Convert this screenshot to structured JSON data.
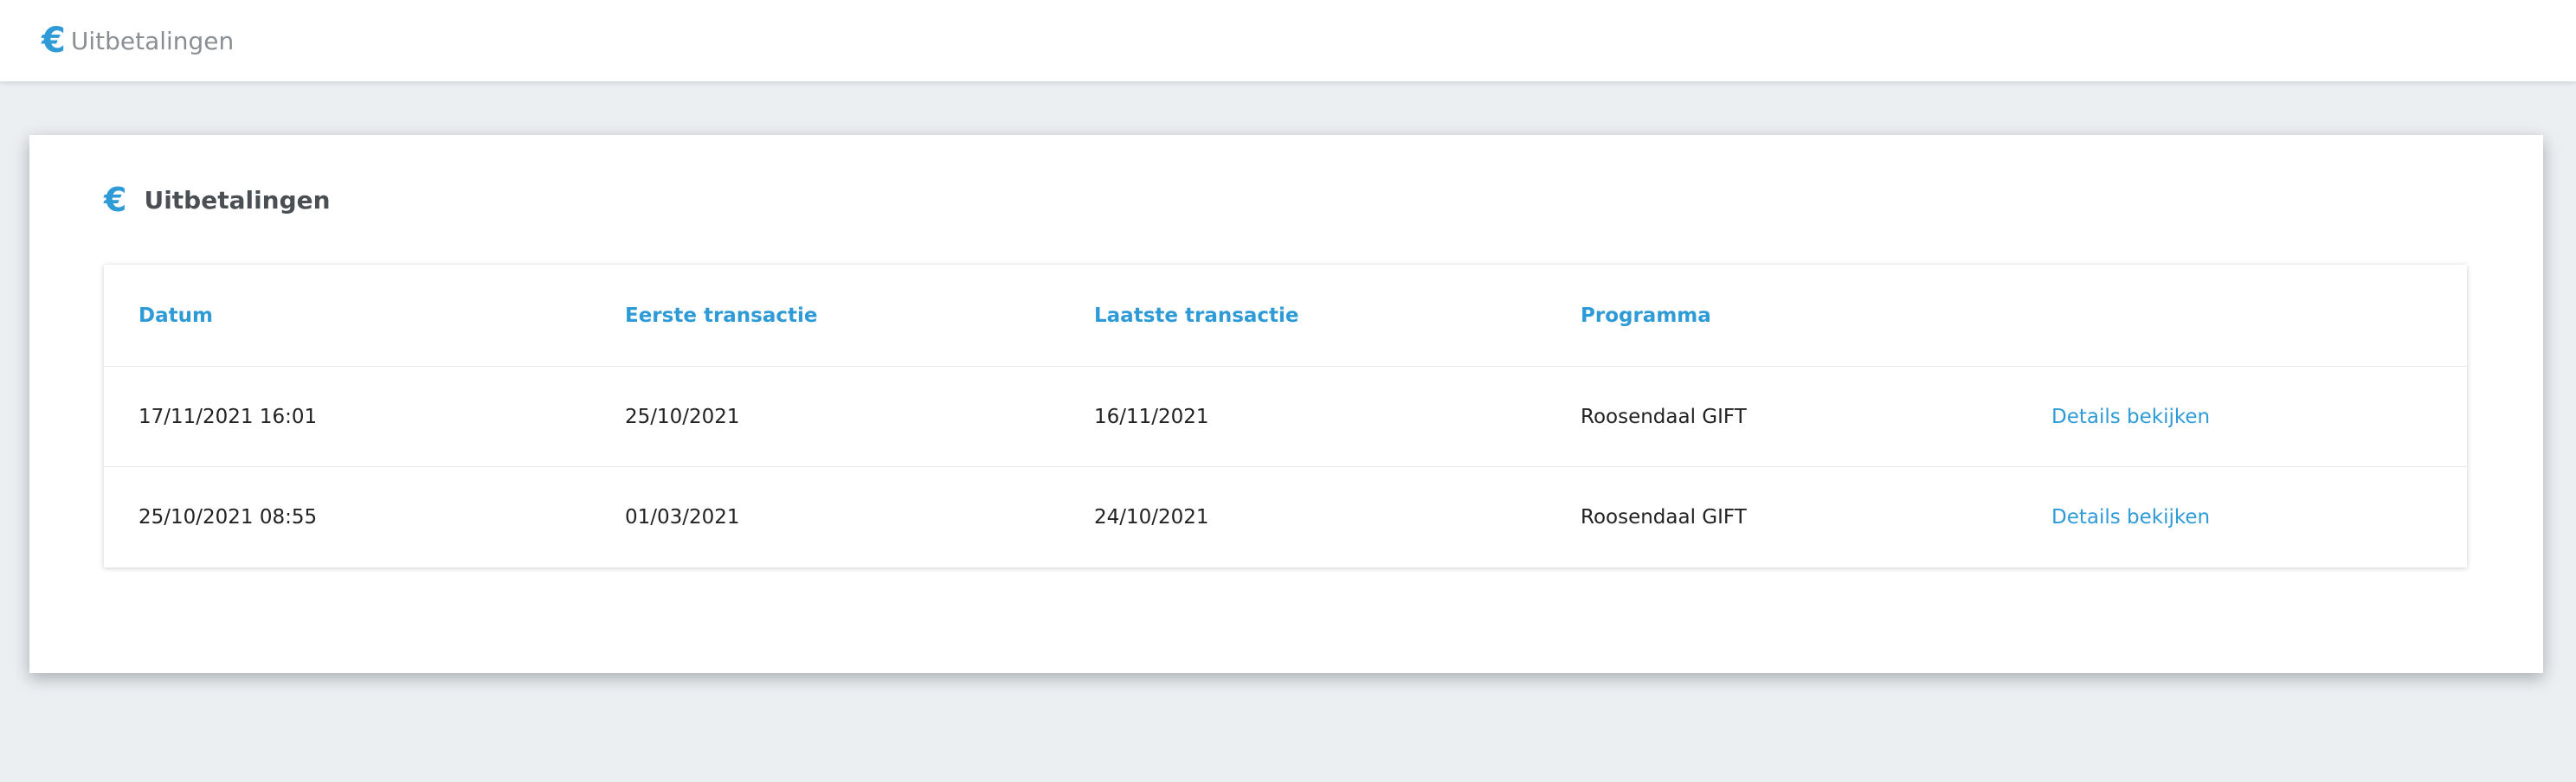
{
  "topbar": {
    "icon": "euro-icon",
    "title": "Uitbetalingen"
  },
  "card": {
    "icon": "euro-icon",
    "title": "Uitbetalingen"
  },
  "table": {
    "columns": [
      "Datum",
      "Eerste transactie",
      "Laatste transactie",
      "Programma",
      ""
    ],
    "rows": [
      {
        "datum": "17/11/2021 16:01",
        "eerste": "25/10/2021",
        "laatste": "16/11/2021",
        "programma": "Roosendaal GIFT",
        "action": "Details bekijken"
      },
      {
        "datum": "25/10/2021 08:55",
        "eerste": "01/03/2021",
        "laatste": "24/10/2021",
        "programma": "Roosendaal GIFT",
        "action": "Details bekijken"
      }
    ]
  },
  "colors": {
    "accent": "#2f9bd6",
    "background": "#ebeff2"
  }
}
